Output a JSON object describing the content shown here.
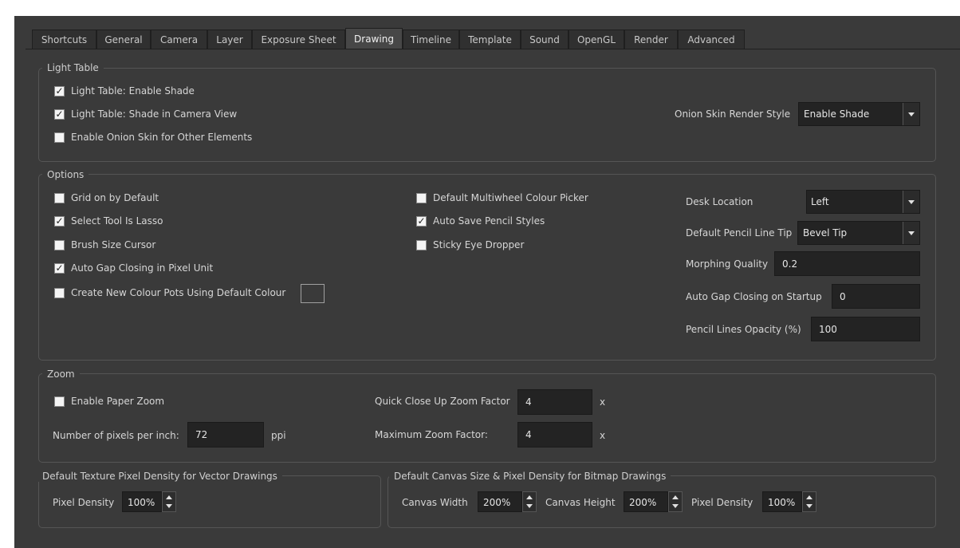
{
  "tabs": [
    "Shortcuts",
    "General",
    "Camera",
    "Layer",
    "Exposure Sheet",
    "Drawing",
    "Timeline",
    "Template",
    "Sound",
    "OpenGL",
    "Render",
    "Advanced"
  ],
  "active_tab": "Drawing",
  "light_table": {
    "title": "Light Table",
    "enable_shade": "Light Table: Enable Shade",
    "shade_camera": "Light Table: Shade in Camera View",
    "onion_other": "Enable Onion Skin for Other Elements",
    "render_style_label": "Onion Skin Render Style",
    "render_style_value": "Enable Shade"
  },
  "options": {
    "title": "Options",
    "grid_default": "Grid on by Default",
    "select_lasso": "Select Tool Is Lasso",
    "brush_cursor": "Brush Size Cursor",
    "auto_gap_pixel": "Auto Gap Closing in Pixel Unit",
    "create_pots": "Create New Colour Pots Using Default Colour",
    "multiwheel": "Default Multiwheel Colour Picker",
    "auto_save_pencil": "Auto Save Pencil Styles",
    "sticky_dropper": "Sticky Eye Dropper",
    "desk_location_label": "Desk Location",
    "desk_location_value": "Left",
    "pencil_tip_label": "Default Pencil Line Tip",
    "pencil_tip_value": "Bevel Tip",
    "morph_label": "Morphing Quality",
    "morph_value": "0.2",
    "gap_startup_label": "Auto Gap Closing on Startup",
    "gap_startup_value": "0",
    "opacity_label": "Pencil Lines Opacity (%)",
    "opacity_value": "100"
  },
  "zoom": {
    "title": "Zoom",
    "paper_zoom": "Enable Paper Zoom",
    "ppi_label": "Number of pixels per inch:",
    "ppi_value": "72",
    "ppi_unit": "ppi",
    "closeup_label": "Quick Close Up Zoom Factor",
    "closeup_value": "4",
    "closeup_unit": "x",
    "maxzoom_label": "Maximum Zoom Factor:",
    "maxzoom_value": "4",
    "maxzoom_unit": "x"
  },
  "vector_density": {
    "title": "Default Texture Pixel Density for Vector Drawings",
    "pixel_density_label": "Pixel Density",
    "pixel_density_value": "100%"
  },
  "bitmap": {
    "title": "Default Canvas Size & Pixel Density for Bitmap Drawings",
    "canvas_width_label": "Canvas Width",
    "canvas_width_value": "200%",
    "canvas_height_label": "Canvas Height",
    "canvas_height_value": "200%",
    "pixel_density_label": "Pixel Density",
    "pixel_density_value": "100%"
  }
}
